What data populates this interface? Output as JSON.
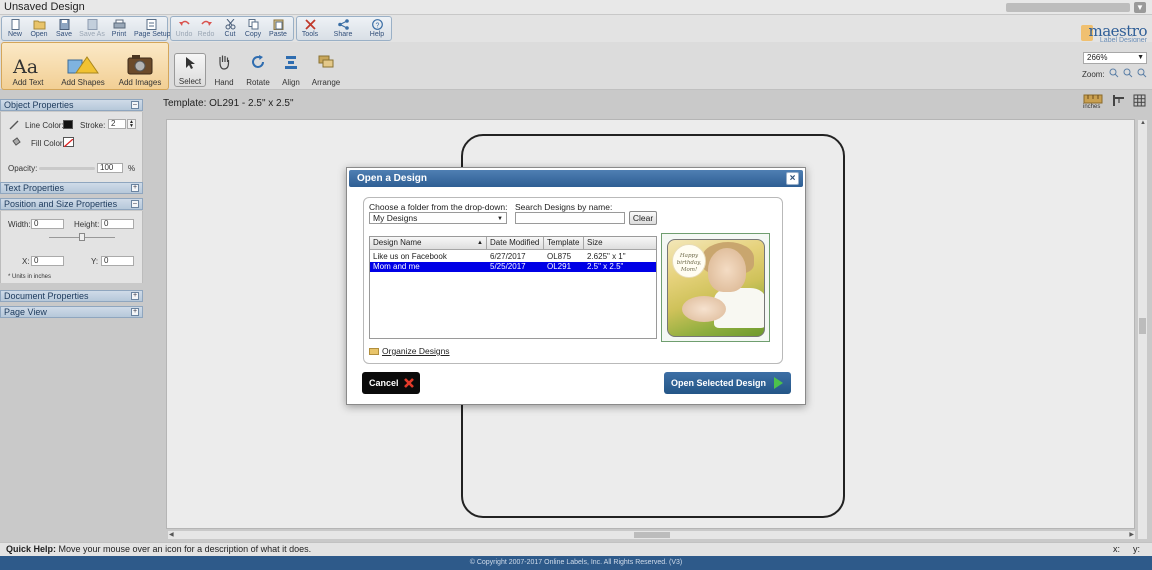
{
  "window": {
    "title": "Unsaved Design"
  },
  "toolbar": {
    "buttons": [
      {
        "label": "New"
      },
      {
        "label": "Open"
      },
      {
        "label": "Save"
      },
      {
        "label": "Save As"
      },
      {
        "label": "Print"
      },
      {
        "label": "Page Setup"
      },
      {
        "label": "Undo"
      },
      {
        "label": "Redo"
      },
      {
        "label": "Cut"
      },
      {
        "label": "Copy"
      },
      {
        "label": "Paste"
      },
      {
        "label": "Tools"
      },
      {
        "label": "Share"
      },
      {
        "label": "Help"
      }
    ]
  },
  "add_toolbar": {
    "add_text": "Add Text",
    "add_shapes": "Add Shapes",
    "add_images": "Add Images"
  },
  "tools": {
    "select": "Select",
    "hand": "Hand",
    "rotate": "Rotate",
    "align": "Align",
    "arrange": "Arrange"
  },
  "logo": {
    "brand": "maestro",
    "sub": "Label Designer"
  },
  "zoom": {
    "value": "266%",
    "label": "Zoom:"
  },
  "left_panel": {
    "object_properties": "Object Properties",
    "line_color": "Line Color:",
    "stroke_label": "Stroke:",
    "stroke_value": "2",
    "fill_color": "Fill Color:",
    "opacity_label": "Opacity:",
    "opacity_value": "100",
    "opacity_unit": "%",
    "text_properties": "Text Properties",
    "position_size": "Position and Size Properties",
    "width_label": "Width:",
    "width_value": "0",
    "height_label": "Height:",
    "height_value": "0",
    "x_label": "X:",
    "x_value": "0",
    "y_label": "Y:",
    "y_value": "0",
    "units_note": "* Units in inches",
    "document_properties": "Document Properties",
    "page_view": "Page View"
  },
  "canvas": {
    "template_label": "Template: OL291 - 2.5\" x 2.5\"",
    "units_label": "inches"
  },
  "status": {
    "quick_help_label": "Quick Help:",
    "quick_help_text": " Move your mouse over an icon for a description of what it does.",
    "x_label": "x:",
    "y_label": "y:",
    "copyright": "© Copyright 2007-2017 Online Labels, Inc. All Rights Reserved. (V3)"
  },
  "dialog": {
    "title": "Open a Design",
    "close": "×",
    "folder_label": "Choose a folder from the drop-down:",
    "folder_value": "My Designs",
    "search_label": "Search Designs by name:",
    "search_value": "",
    "clear_button": "Clear",
    "columns": [
      "Design Name",
      "Date Modified",
      "Template",
      "Size"
    ],
    "rows": [
      {
        "name": "Like us on Facebook",
        "date": "6/27/2017",
        "template": "OL875",
        "size": "2.625\" x 1\""
      },
      {
        "name": "Mom and me",
        "date": "5/25/2017",
        "template": "OL291",
        "size": "2.5\" x 2.5\""
      }
    ],
    "selected_row": 1,
    "preview_text": "Happy birthday, Mom!",
    "organize_link": "Organize Designs",
    "cancel_button": "Cancel",
    "open_button": "Open Selected Design"
  },
  "colors": {
    "accent_blue": "#2e5e93",
    "selection": "#0000e6",
    "add_group": "#f2cf94",
    "open_play": "#4cc24c",
    "cancel_x": "#e23a2a"
  }
}
